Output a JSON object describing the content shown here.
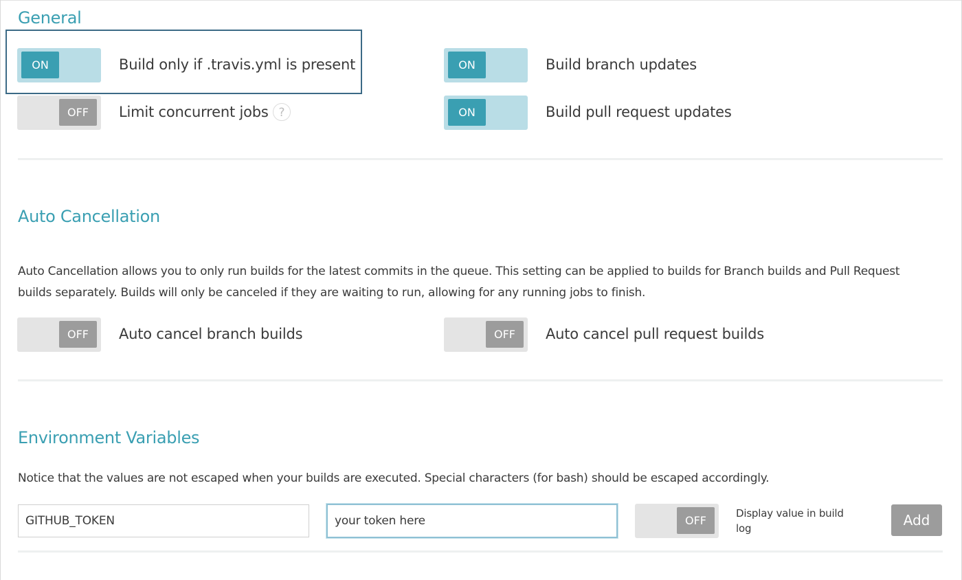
{
  "general": {
    "heading": "General",
    "build_only_if_yml": {
      "state": "ON",
      "label": "Build only if .travis.yml is present"
    },
    "build_branch_updates": {
      "state": "ON",
      "label": "Build branch updates"
    },
    "limit_concurrent_jobs": {
      "state": "OFF",
      "label": "Limit concurrent jobs",
      "help": "?"
    },
    "build_pull_request_updates": {
      "state": "ON",
      "label": "Build pull request updates"
    }
  },
  "auto_cancellation": {
    "heading": "Auto Cancellation",
    "description": "Auto Cancellation allows you to only run builds for the latest commits in the queue. This setting can be applied to builds for Branch builds and Pull Request builds separately. Builds will only be canceled if they are waiting to run, allowing for any running jobs to finish.",
    "branch_builds": {
      "state": "OFF",
      "label": "Auto cancel branch builds"
    },
    "pull_request_builds": {
      "state": "OFF",
      "label": "Auto cancel pull request builds"
    }
  },
  "environment_variables": {
    "heading": "Environment Variables",
    "notice": "Notice that the values are not escaped when your builds are executed. Special characters (for bash) should be escaped accordingly.",
    "name_value": "GITHUB_TOKEN",
    "value_value": "your token here",
    "display_toggle_state": "OFF",
    "display_label": "Display value in build log",
    "add_label": "Add"
  },
  "colors": {
    "accent": "#3a9fb2",
    "toggle_on_track": "#b9dde6",
    "toggle_off_track": "#e4e4e4",
    "toggle_off_knob": "#9c9c9c",
    "focus_outline": "#3b6a86"
  }
}
